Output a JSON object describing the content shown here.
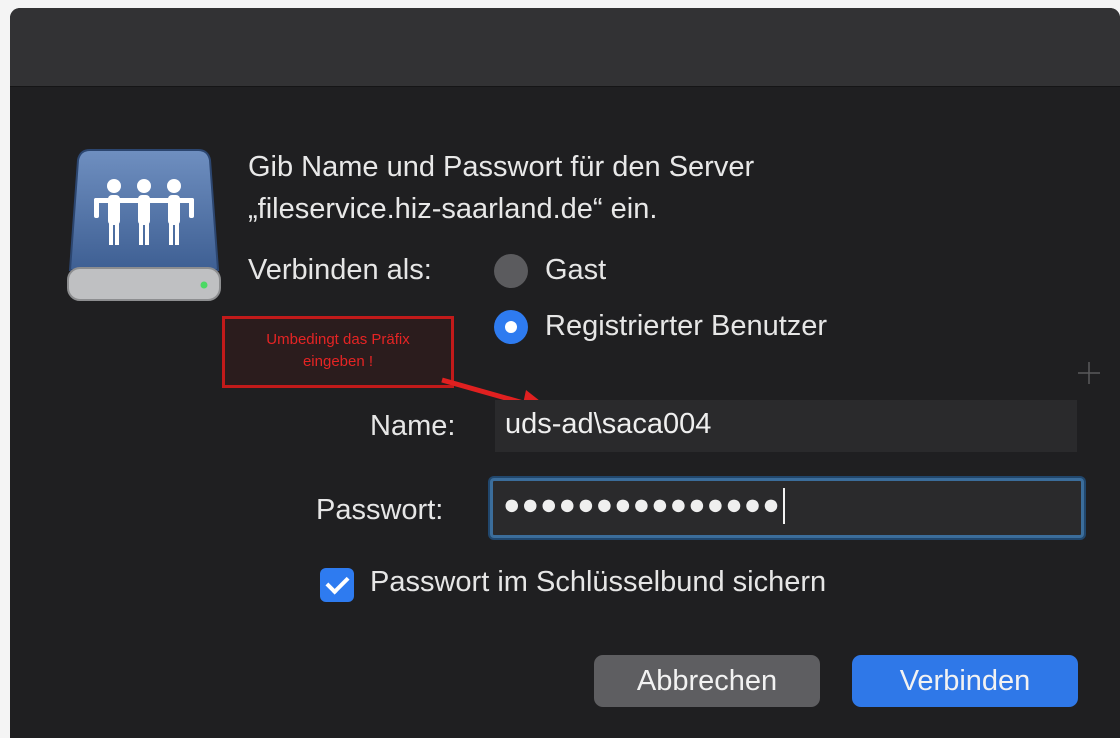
{
  "dialog": {
    "prompt_line1": "Gib Name und Passwort für den Server",
    "prompt_line2": "„fileservice.hiz-saarland.de“ ein.",
    "connect_as_label": "Verbinden als:",
    "radio_guest_label": "Gast",
    "radio_registered_label": "Registrierter Benutzer",
    "selected_radio": "Registrierter Benutzer",
    "name_label": "Name:",
    "name_value": "uds-ad\\saca004",
    "password_label": "Passwort:",
    "password_value": "●●●●●●●●●●●●●●●",
    "keychain_label": "Passwort im Schlüsselbund sichern",
    "keychain_checked": true,
    "cancel_label": "Abbrechen",
    "connect_label": "Verbinden"
  },
  "annotation": {
    "line1": "Umbedingt das Präfix",
    "line2": "eingeben !",
    "color": "#e52424"
  },
  "icons": {
    "server": "shared-server-icon",
    "arrow": "red-arrow"
  },
  "colors": {
    "accent": "#2f78e8",
    "window_background": "#1f1f21"
  }
}
